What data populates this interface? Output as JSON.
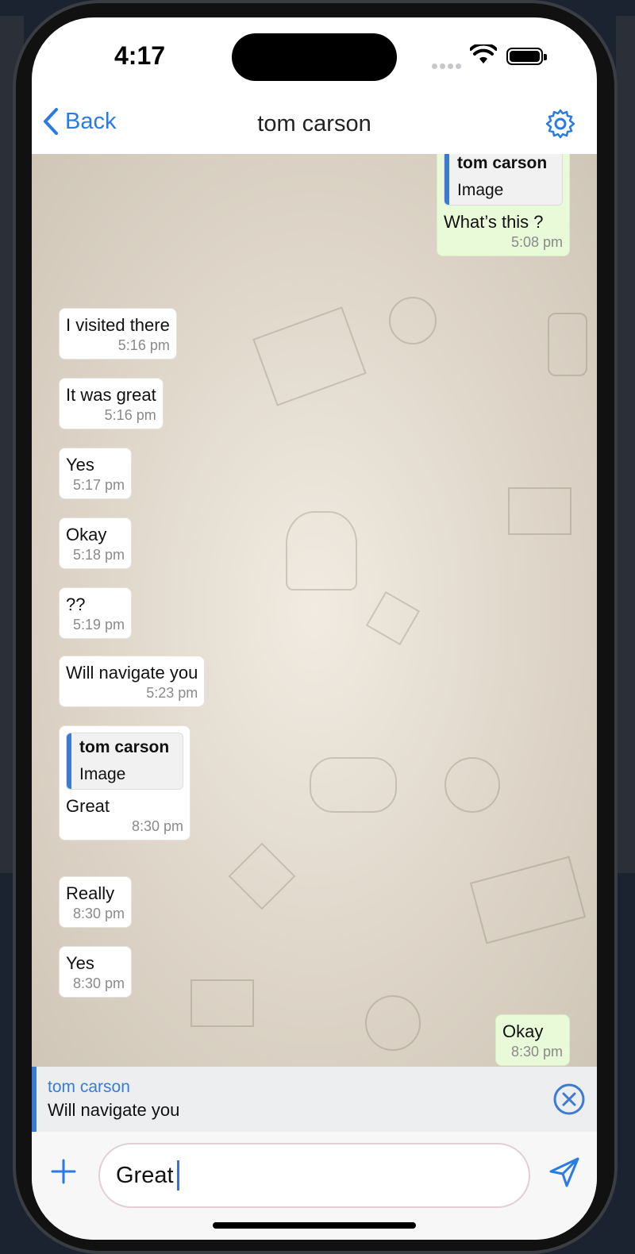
{
  "status": {
    "time": "4:17"
  },
  "nav": {
    "back_label": "Back",
    "title": "tom carson",
    "icons": {
      "back": "chevron-left-icon",
      "settings": "gear-icon"
    }
  },
  "messages": [
    {
      "dir": "out",
      "reply_name": "tom carson",
      "reply_text": "Image",
      "text": "What’s this ?",
      "time": "5:08 pm"
    },
    {
      "dir": "in",
      "text": "I visited there",
      "time": "5:16 pm"
    },
    {
      "dir": "in",
      "text": "It was great",
      "time": "5:16 pm"
    },
    {
      "dir": "in",
      "text": "Yes",
      "time": "5:17 pm"
    },
    {
      "dir": "in",
      "text": "Okay",
      "time": "5:18 pm"
    },
    {
      "dir": "in",
      "text": "??",
      "time": "5:19 pm"
    },
    {
      "dir": "in",
      "text": "Will navigate you",
      "time": "5:23 pm"
    },
    {
      "dir": "in",
      "reply_name": "tom carson",
      "reply_text": "Image",
      "text": "Great",
      "time": "8:30 pm"
    },
    {
      "dir": "in",
      "text": "Really",
      "time": "8:30 pm"
    },
    {
      "dir": "in",
      "text": "Yes",
      "time": "8:30 pm"
    },
    {
      "dir": "out",
      "text": "Okay",
      "time": "8:30 pm"
    }
  ],
  "reply_banner": {
    "name": "tom carson",
    "text": "Will navigate you",
    "icon": "close-circle-icon"
  },
  "composer": {
    "value": "Great",
    "icons": {
      "attach": "plus-icon",
      "send": "send-icon"
    }
  },
  "colors": {
    "accent": "#2a7be4",
    "reply_bar": "#3b7bd6",
    "outgoing": "#e8fad8",
    "incoming": "#ffffff"
  }
}
